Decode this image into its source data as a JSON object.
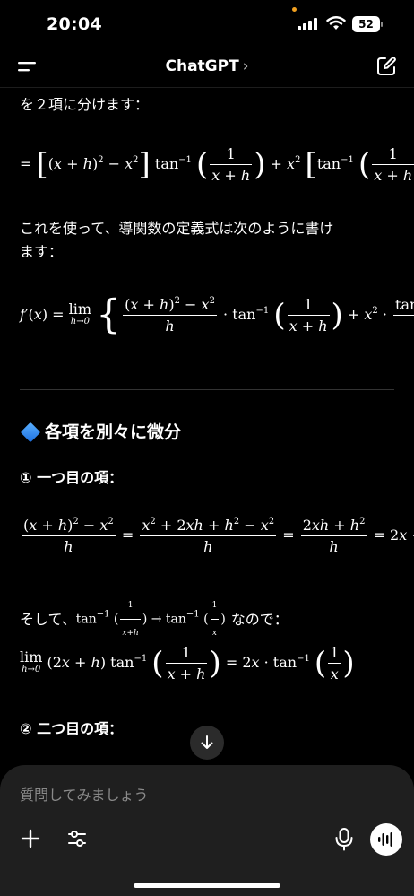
{
  "status": {
    "time": "20:04",
    "battery": "52"
  },
  "nav": {
    "title": "ChatGPT",
    "chevron": "›"
  },
  "content": {
    "intro": "を２項に分けます：",
    "para1_line1": "これを使って、導関数の定義式は次のように書け",
    "para1_line2": "ます：",
    "section_heading": "各項を別々に微分",
    "term1_heading": "① 一つ目の項：",
    "then_prefix": "そして、",
    "then_suffix": "なので：",
    "term2_heading": "② 二つ目の項："
  },
  "composer": {
    "placeholder": "質問してみましょう"
  },
  "colors": {
    "background": "#000000",
    "composer": "#1f1f1f",
    "accent_diamond": "#2f86f0"
  },
  "icons": [
    "menu-icon",
    "new-chat-icon",
    "arrow-down-icon",
    "plus-icon",
    "sliders-icon",
    "mic-icon",
    "voice-wave-icon"
  ]
}
